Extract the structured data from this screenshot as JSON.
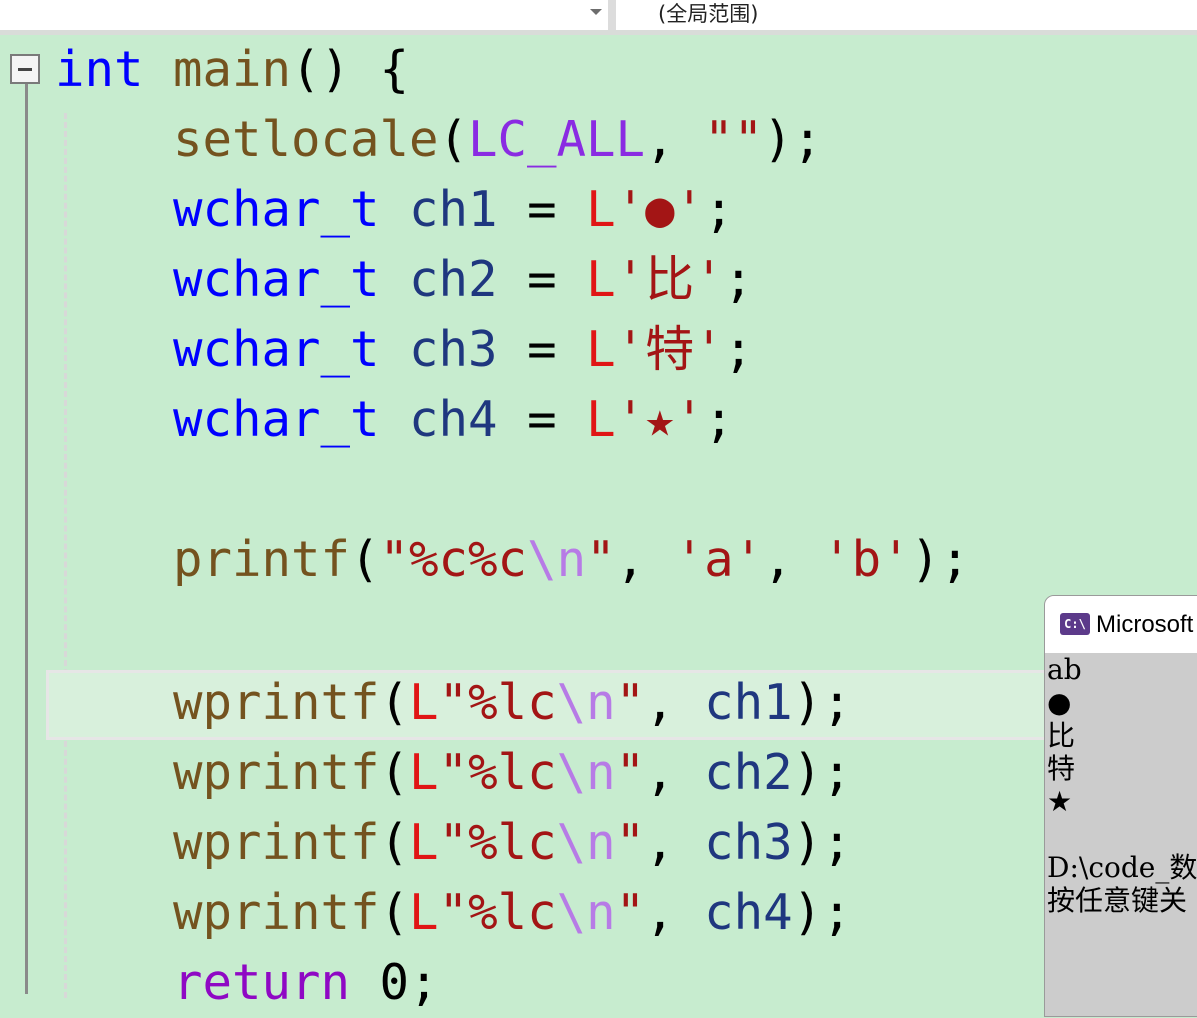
{
  "nav_bar": {
    "scope_label": "(全局范围)"
  },
  "code": {
    "line1": {
      "kw": "int",
      "name": "main",
      "rest": "() {"
    },
    "line2": {
      "fn": "setlocale",
      "open": "(",
      "macro": "LC_ALL",
      "sep": ", ",
      "str": "\"\"",
      "close": ");"
    },
    "decls": [
      {
        "type": "wchar_t",
        "name": "ch1",
        "eq": " = ",
        "prefix": "L",
        "char": "'●'",
        "end": ";"
      },
      {
        "type": "wchar_t",
        "name": "ch2",
        "eq": " = ",
        "prefix": "L",
        "char": "'比'",
        "end": ";"
      },
      {
        "type": "wchar_t",
        "name": "ch3",
        "eq": " = ",
        "prefix": "L",
        "char": "'特'",
        "end": ";"
      },
      {
        "type": "wchar_t",
        "name": "ch4",
        "eq": " = ",
        "prefix": "L",
        "char": "'★'",
        "end": ";"
      }
    ],
    "printf": {
      "fn": "printf",
      "open": "(",
      "fmt": "\"%c%c",
      "esc": "\\n",
      "q": "\"",
      "sep1": ", ",
      "a": "'a'",
      "sep2": ", ",
      "b": "'b'",
      "close": ");"
    },
    "wprintfs": [
      {
        "fn": "wprintf",
        "open": "(",
        "prefix": "L",
        "fmt": "\"%lc",
        "esc": "\\n",
        "q": "\"",
        "sep": ", ",
        "arg": "ch1",
        "close": ");"
      },
      {
        "fn": "wprintf",
        "open": "(",
        "prefix": "L",
        "fmt": "\"%lc",
        "esc": "\\n",
        "q": "\"",
        "sep": ", ",
        "arg": "ch2",
        "close": ");"
      },
      {
        "fn": "wprintf",
        "open": "(",
        "prefix": "L",
        "fmt": "\"%lc",
        "esc": "\\n",
        "q": "\"",
        "sep": ", ",
        "arg": "ch3",
        "close": ");"
      },
      {
        "fn": "wprintf",
        "open": "(",
        "prefix": "L",
        "fmt": "\"%lc",
        "esc": "\\n",
        "q": "\"",
        "sep": ", ",
        "arg": "ch4",
        "close": ");"
      }
    ],
    "return": {
      "kw": "return",
      "rest": " 0;"
    }
  },
  "console": {
    "icon_text": "C:\\",
    "title": "Microsoft",
    "output": [
      "ab",
      "●",
      "比",
      "特",
      "★",
      "",
      "D:\\code_数",
      "按任意键关"
    ]
  },
  "colors": {
    "editor_bg": "#c7eccf",
    "keyword": "#0000ff",
    "function": "#74531f",
    "macro": "#8a2be2",
    "variable": "#1f377f",
    "string": "#a31515",
    "escape": "#b77be6",
    "console_bg": "#cccccc"
  }
}
